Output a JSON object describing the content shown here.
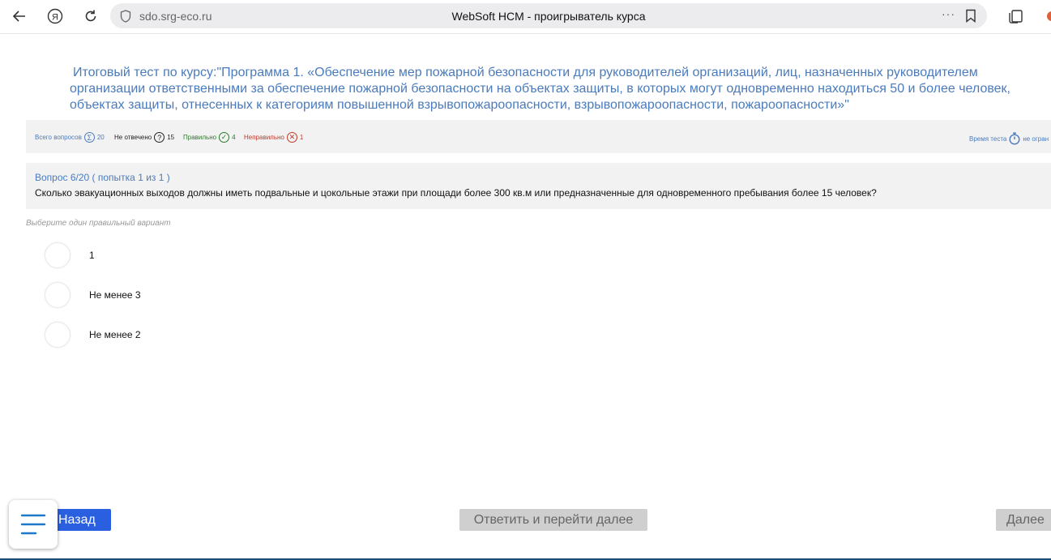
{
  "browser": {
    "url": "sdo.srg-eco.ru",
    "page_title": "WebSoft HCM - проигрыватель курса",
    "more": "···"
  },
  "course": {
    "title": "Итоговый тест по курсу:\"Программа 1. «Обеспечение мер пожарной безопасности для руководителей организаций, лиц, назначенных руководителем организации ответственными за обеспечение пожарной безопасности на объектах защиты, в которых могут одновременно находиться 50 и более человек, объектах защиты, отнесенных к категориям повышенной взрывопожароопасности, взрывопожароопасности, пожароопасности»\""
  },
  "stats": {
    "total_label": "Всего вопросов",
    "total_value": "20",
    "unanswered_label": "Не отвечено",
    "unanswered_value": "15",
    "correct_label": "Правильно",
    "correct_value": "4",
    "incorrect_label": "Неправильно",
    "incorrect_value": "1",
    "time_label": "Время теста",
    "time_value": "не огран"
  },
  "question": {
    "number": "Вопрос 6/20  ( попытка  1 из 1 )",
    "text": "Сколько эвакуационных выходов должны иметь подвальные и цокольные этажи при площади более 300 кв.м или предназначенные для одновременного пребывания более 15 человек?",
    "hint": "Выберите один правильный вариант",
    "options": [
      {
        "label": "1"
      },
      {
        "label": "Не менее 3"
      },
      {
        "label": "Не менее 2"
      }
    ]
  },
  "controls": {
    "back": "Назад",
    "answer": "Ответить и перейти далее",
    "next": "Далее"
  },
  "colors": {
    "accent_blue": "#4a7bbd",
    "button_blue": "#2a5fe0",
    "correct_green": "#2a7a2a",
    "incorrect_red": "#c0392b"
  }
}
